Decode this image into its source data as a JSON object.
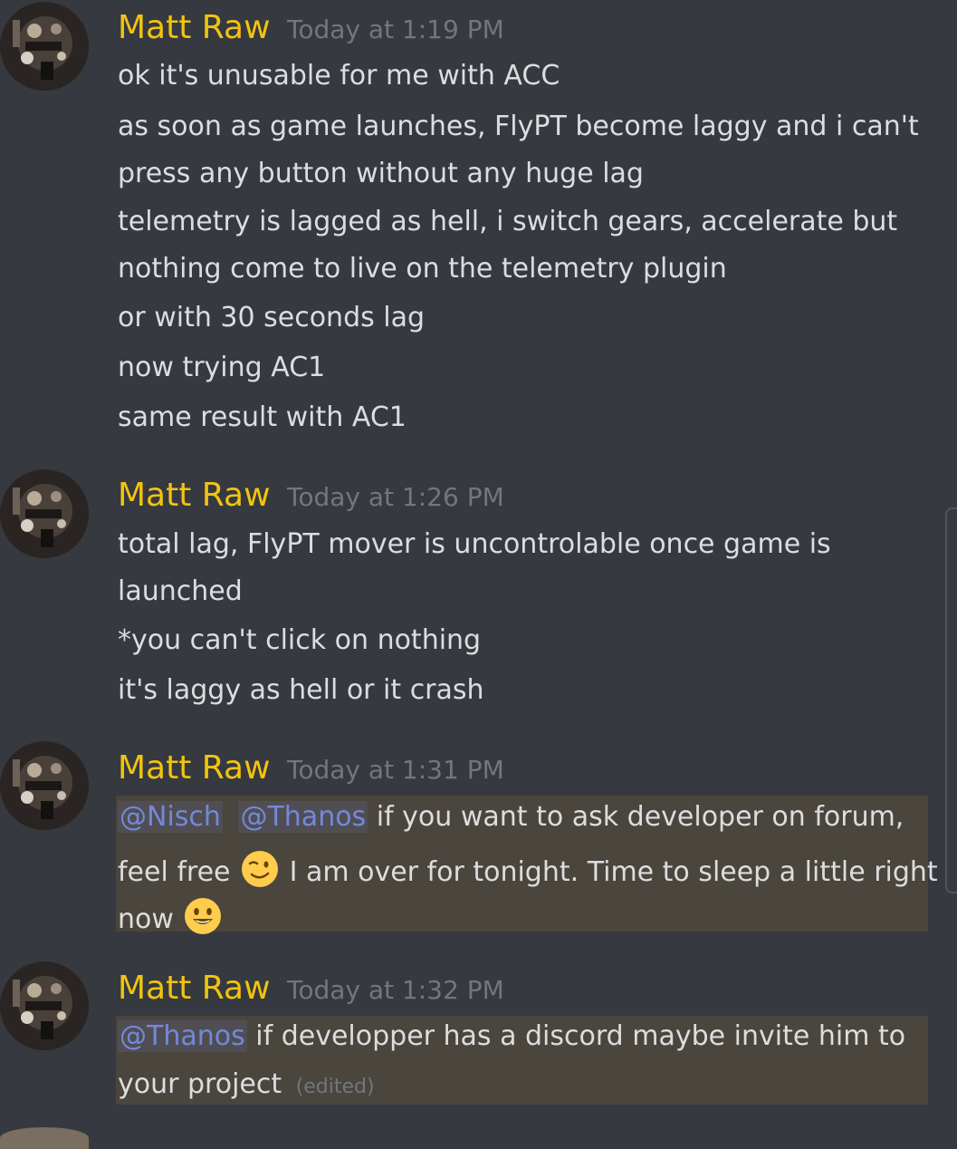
{
  "messages": [
    {
      "username": "Matt Raw",
      "timestamp": "Today at 1:19 PM",
      "lines": [
        "ok it's unusable for me with ACC",
        "as soon as game launches, FlyPT become laggy and i can't",
        "press any button without any huge lag",
        "telemetry is lagged as hell, i switch gears, accelerate but",
        "nothing come to live on the telemetry plugin",
        "or with 30 seconds lag",
        "now trying AC1",
        "same result with AC1"
      ]
    },
    {
      "username": "Matt Raw",
      "timestamp": "Today at 1:26 PM",
      "lines": [
        "total lag, FlyPT mover is uncontrolable once game is",
        "launched",
        "*you can't click on nothing",
        "it's laggy as hell or it crash"
      ]
    },
    {
      "username": "Matt Raw",
      "timestamp": "Today at 1:31 PM",
      "mention1": "@Nisch",
      "mention2": "@Thanos",
      "line1_text": " if you want to ask developer on forum,",
      "line2_text_a": "feel free",
      "line2_text_b": "I am over for tonight. Time to sleep a little right",
      "line3_text": "now",
      "emoji1": "wink-emoji",
      "emoji2": "smile-emoji"
    },
    {
      "username": "Matt Raw",
      "timestamp": "Today at 1:32 PM",
      "mention1": "@Thanos",
      "line1_text": " if developper has a discord maybe invite him to",
      "line2_text": "your project",
      "edited": "(edited)"
    }
  ],
  "colors": {
    "background": "#36393f",
    "username": "#f1c40f",
    "timestamp": "#72767d",
    "text": "#dcddde",
    "mention": "#7289da",
    "highlight": "#4a453d"
  }
}
